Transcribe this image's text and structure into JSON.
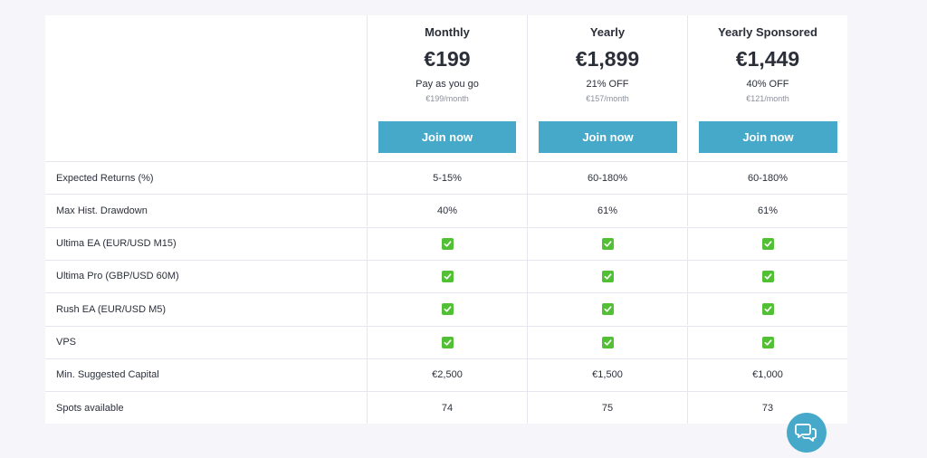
{
  "plans": [
    {
      "name": "Monthly",
      "price": "€199",
      "subtitle": "Pay as you go",
      "per_month": "€199/month",
      "cta": "Join now"
    },
    {
      "name": "Yearly",
      "price": "€1,899",
      "subtitle": "21% OFF",
      "per_month": "€157/month",
      "cta": "Join now"
    },
    {
      "name": "Yearly Sponsored",
      "price": "€1,449",
      "subtitle": "40% OFF",
      "per_month": "€121/month",
      "cta": "Join now"
    }
  ],
  "rows": [
    {
      "label": "Expected Returns (%)",
      "values": [
        "5-15%",
        "60-180%",
        "60-180%"
      ]
    },
    {
      "label": "Max Hist. Drawdown",
      "values": [
        "40%",
        "61%",
        "61%"
      ]
    },
    {
      "label": "Ultima EA (EUR/USD M15)",
      "values": [
        "check",
        "check",
        "check"
      ]
    },
    {
      "label": "Ultima Pro (GBP/USD 60M)",
      "values": [
        "check",
        "check",
        "check"
      ]
    },
    {
      "label": "Rush EA (EUR/USD M5)",
      "values": [
        "check",
        "check",
        "check"
      ]
    },
    {
      "label": "VPS",
      "values": [
        "check",
        "check",
        "check"
      ]
    },
    {
      "label": "Min. Suggested Capital",
      "values": [
        "€2,500",
        "€1,500",
        "€1,000"
      ]
    },
    {
      "label": "Spots available",
      "values": [
        "74",
        "75",
        "73"
      ]
    }
  ],
  "colors": {
    "accent": "#47a9c9",
    "check": "#52c034"
  },
  "icons": {
    "check": "check-mark-icon",
    "chat": "chat-bubbles-icon"
  }
}
